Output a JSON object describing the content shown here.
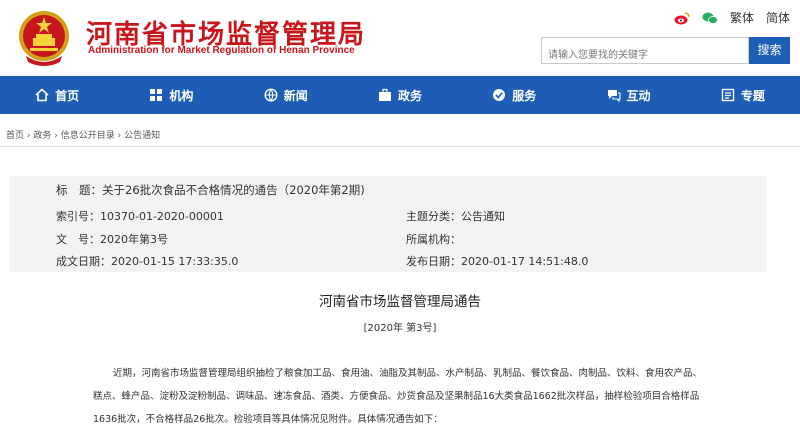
{
  "header": {
    "title": "河南省市场监督管理局",
    "subtitle": "Administration for Market Regulation of Henan Province",
    "links": {
      "traditional": "繁体",
      "simplified": "简体"
    },
    "search": {
      "placeholder": "请输入您要找的关键字",
      "button": "搜索"
    },
    "brand_color": "#c8161d"
  },
  "nav": {
    "accent": "#1e5db5",
    "items": [
      {
        "label": "首页",
        "icon": "home-icon"
      },
      {
        "label": "机构",
        "icon": "org-chart-icon"
      },
      {
        "label": "新闻",
        "icon": "globe-icon"
      },
      {
        "label": "政务",
        "icon": "briefcase-icon"
      },
      {
        "label": "服务",
        "icon": "service-icon"
      },
      {
        "label": "互动",
        "icon": "interaction-icon"
      },
      {
        "label": "专题",
        "icon": "topic-icon"
      }
    ]
  },
  "breadcrumb": [
    "首页",
    "政务",
    "信息公开目录",
    "公告通知"
  ],
  "meta": {
    "title_label": "标　题：",
    "title_value": "关于26批次食品不合格情况的通告（2020年第2期)",
    "index_label": "索引号：",
    "index_value": "10370-01-2020-00001",
    "category_label": "主题分类：",
    "category_value": "公告通知",
    "docno_label": "文　号：",
    "docno_value": "2020年第3号",
    "org_label": "所属机构：",
    "org_value": "",
    "created_label": "成文日期：",
    "created_value": "2020-01-15 17:33:35.0",
    "published_label": "发布日期：",
    "published_value": "2020-01-17 14:51:48.0"
  },
  "document": {
    "heading": "河南省市场监督管理局通告",
    "number": "[2020年 第3号]",
    "lines": [
      "近期，河南省市场监督管理局组织抽检了粮食加工品、食用油、油脂及其制品、水产制品、乳制品、餐饮食品、肉制品、饮料、食用农产品、",
      "糕点、蜂产品、淀粉及淀粉制品、调味品、速冻食品、酒类、方便食品、炒货食品及坚果制品16大类食品1662批次样品，抽样检验项目合格样品",
      "1636批次，不合格样品26批次。检验项目等具体情况见附件。具体情况通告如下："
    ]
  }
}
